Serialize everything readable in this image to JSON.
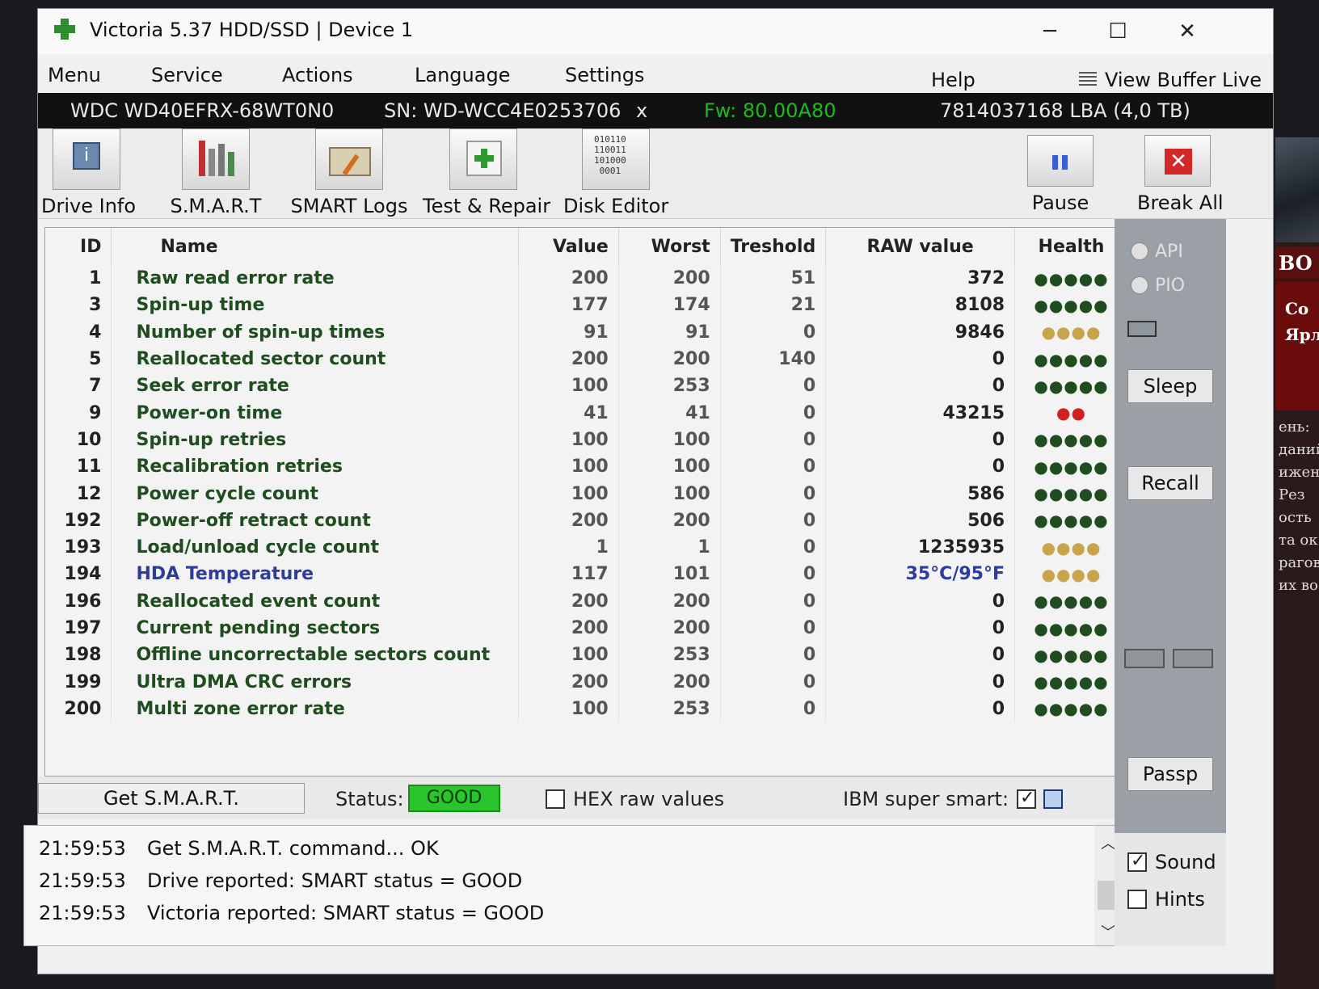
{
  "window": {
    "title": "Victoria 5.37 HDD/SSD | Device 1"
  },
  "menu": [
    "Menu",
    "Service",
    "Actions",
    "Language",
    "Settings",
    "Help"
  ],
  "view_buffer_label": "View Buffer Live",
  "device": {
    "model": "WDC WD40EFRX-68WT0N0",
    "serial": "SN: WD-WCC4E0253706",
    "close": "x",
    "firmware": "Fw: 80.00A80",
    "capacity": "7814037168 LBA (4,0 TB)"
  },
  "toolbar": {
    "drive_info": "Drive Info",
    "smart": "S.M.A.R.T",
    "smart_logs": "SMART Logs",
    "test_repair": "Test & Repair",
    "disk_editor": "Disk Editor",
    "disk_editor_bits": "010110\n110011\n101000\n0001",
    "pause": "Pause",
    "break_all": "Break All"
  },
  "table": {
    "headers": [
      "ID",
      "Name",
      "Value",
      "Worst",
      "Treshold",
      "RAW value",
      "Health"
    ],
    "rows": [
      {
        "id": "1",
        "name": "Raw read error rate",
        "value": "200",
        "worst": "200",
        "threshold": "51",
        "raw": "372",
        "health": "●●●●●",
        "health_color": "#1f4d1f"
      },
      {
        "id": "3",
        "name": "Spin-up time",
        "value": "177",
        "worst": "174",
        "threshold": "21",
        "raw": "8108",
        "health": "●●●●●",
        "health_color": "#1f4d1f"
      },
      {
        "id": "4",
        "name": "Number of spin-up times",
        "value": "91",
        "worst": "91",
        "threshold": "0",
        "raw": "9846",
        "health": "●●●●",
        "health_color": "#c8a44a"
      },
      {
        "id": "5",
        "name": "Reallocated sector count",
        "value": "200",
        "worst": "200",
        "threshold": "140",
        "raw": "0",
        "health": "●●●●●",
        "health_color": "#1f4d1f"
      },
      {
        "id": "7",
        "name": "Seek error rate",
        "value": "100",
        "worst": "253",
        "threshold": "0",
        "raw": "0",
        "health": "●●●●●",
        "health_color": "#1f4d1f"
      },
      {
        "id": "9",
        "name": "Power-on time",
        "value": "41",
        "worst": "41",
        "threshold": "0",
        "raw": "43215",
        "health": "●●",
        "health_color": "#d02020"
      },
      {
        "id": "10",
        "name": "Spin-up retries",
        "value": "100",
        "worst": "100",
        "threshold": "0",
        "raw": "0",
        "health": "●●●●●",
        "health_color": "#1f4d1f"
      },
      {
        "id": "11",
        "name": "Recalibration retries",
        "value": "100",
        "worst": "100",
        "threshold": "0",
        "raw": "0",
        "health": "●●●●●",
        "health_color": "#1f4d1f"
      },
      {
        "id": "12",
        "name": "Power cycle count",
        "value": "100",
        "worst": "100",
        "threshold": "0",
        "raw": "586",
        "health": "●●●●●",
        "health_color": "#1f4d1f"
      },
      {
        "id": "192",
        "name": "Power-off retract count",
        "value": "200",
        "worst": "200",
        "threshold": "0",
        "raw": "506",
        "health": "●●●●●",
        "health_color": "#1f4d1f"
      },
      {
        "id": "193",
        "name": "Load/unload cycle count",
        "value": "1",
        "worst": "1",
        "threshold": "0",
        "raw": "1235935",
        "health": "●●●●",
        "health_color": "#c8a44a"
      },
      {
        "id": "194",
        "name": "HDA Temperature",
        "value": "117",
        "worst": "101",
        "threshold": "0",
        "raw": "35°C/95°F",
        "health": "●●●●",
        "health_color": "#c8a44a",
        "temp": true
      },
      {
        "id": "196",
        "name": "Reallocated event count",
        "value": "200",
        "worst": "200",
        "threshold": "0",
        "raw": "0",
        "health": "●●●●●",
        "health_color": "#1f4d1f"
      },
      {
        "id": "197",
        "name": "Current pending sectors",
        "value": "200",
        "worst": "200",
        "threshold": "0",
        "raw": "0",
        "health": "●●●●●",
        "health_color": "#1f4d1f"
      },
      {
        "id": "198",
        "name": "Offline uncorrectable sectors count",
        "value": "100",
        "worst": "253",
        "threshold": "0",
        "raw": "0",
        "health": "●●●●●",
        "health_color": "#1f4d1f"
      },
      {
        "id": "199",
        "name": "Ultra DMA CRC errors",
        "value": "200",
        "worst": "200",
        "threshold": "0",
        "raw": "0",
        "health": "●●●●●",
        "health_color": "#1f4d1f"
      },
      {
        "id": "200",
        "name": "Multi zone error rate",
        "value": "100",
        "worst": "253",
        "threshold": "0",
        "raw": "0",
        "health": "●●●●●",
        "health_color": "#1f4d1f"
      }
    ]
  },
  "bottom": {
    "get_smart": "Get S.M.A.R.T.",
    "status_label": "Status:",
    "status_value": "GOOD",
    "hex_raw": "HEX raw values",
    "hex_raw_checked": false,
    "ibm_super_smart": "IBM super smart:",
    "ibm_checked": true
  },
  "log": [
    {
      "time": "21:59:53",
      "msg": "Get S.M.A.R.T. command... OK"
    },
    {
      "time": "21:59:53",
      "msg": "Drive reported: SMART status = GOOD"
    },
    {
      "time": "21:59:53",
      "msg": "Victoria reported: SMART status = GOOD"
    }
  ],
  "side": {
    "api": "API",
    "pio": "PIO",
    "sleep": "Sleep",
    "recall": "Recall",
    "passp": "Passp",
    "sound": "Sound",
    "sound_checked": true,
    "hints": "Hints",
    "hints_checked": false
  },
  "desktop": {
    "banner": "BO",
    "red_line1": "Co",
    "red_line2": "Ярл",
    "text_lines": [
      "ень:",
      "даний",
      "ижен",
      "Рез",
      "ость",
      "та ок",
      "рагов",
      "их во"
    ]
  },
  "colors": {
    "status_good": "#2cc42c",
    "firmware": "#1fb81f",
    "temperature": "#2e3c9a",
    "attribute_name": "#1f4d1f"
  }
}
